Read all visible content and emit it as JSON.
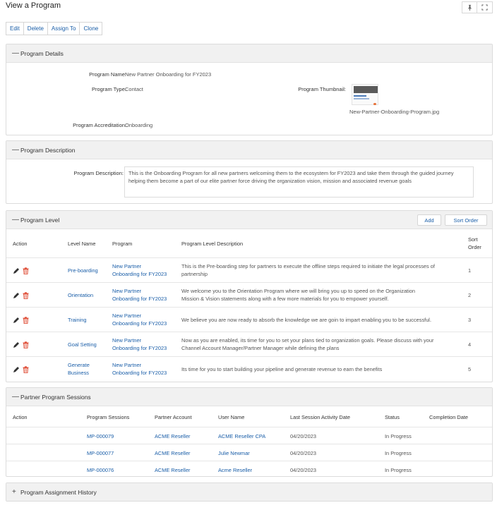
{
  "page": {
    "title": "View a Program",
    "pin_icon": "pin-icon",
    "expand_icon": "expand-icon"
  },
  "toolbar": {
    "edit": "Edit",
    "delete": "Delete",
    "assign_to": "Assign To",
    "clone": "Clone"
  },
  "details": {
    "section_title": "Program Details",
    "toggle": "—",
    "name_label": "Program Name:",
    "name_value": "New Partner Onboarding for FY2023",
    "type_label": "Program Type:",
    "type_value": "Contact",
    "thumb_label": "Program Thumbnail:",
    "thumb_file": "New-Partner-Onboarding-Program.jpg",
    "accred_label": "Program Accreditation:",
    "accred_value": "Onboarding"
  },
  "description": {
    "section_title": "Program Description",
    "toggle": "—",
    "label": "Program Description:",
    "text": "This is the Onboarding Program for all new partners welcoming them to the ecosystem for FY2023 and take them through the guided journey helping them become a part of our elite partner force driving the organization vision, mission and associated revenue goals"
  },
  "levels": {
    "section_title": "Program Level",
    "toggle": "—",
    "add_label": "Add",
    "sort_label": "Sort Order",
    "columns": {
      "action": "Action",
      "level_name": "Level Name",
      "program": "Program",
      "description": "Program Level Description",
      "sort_1": "Sort",
      "sort_2": "Order"
    },
    "rows": [
      {
        "name_1": "Pre-boarding",
        "name_2": "",
        "program_1": "New Partner",
        "program_2": "Onboarding for FY2023",
        "desc_1": "This is the Pre-boarding step for partners to execute the offline steps required to initiate the legal processes of",
        "desc_2": "partnership",
        "sort": "1"
      },
      {
        "name_1": "Orientation",
        "name_2": "",
        "program_1": "New Partner",
        "program_2": "Onboarding for FY2023",
        "desc_1": "We welcome you to the Orientation Program where we will bring you up to speed on the Organization",
        "desc_2": "Mission & Vision statements along with a few more materials for you to empower yourself.",
        "sort": "2"
      },
      {
        "name_1": "Training",
        "name_2": "",
        "program_1": "New Partner",
        "program_2": "Onboarding for FY2023",
        "desc_1": "We believe you are now ready to absorb the knowledge we are goin to impart enabling you to be successful.",
        "desc_2": "",
        "sort": "3"
      },
      {
        "name_1": "Goal Setting",
        "name_2": "",
        "program_1": "New Partner",
        "program_2": "Onboarding for FY2023",
        "desc_1": "Now as you are enabled, its time for you to set your plans tied to organization goals. Please discuss with your",
        "desc_2": "Channel Account Manager/Partner Manager while defining the plans",
        "sort": "4"
      },
      {
        "name_1": "Generate",
        "name_2": "Business",
        "program_1": "New Partner",
        "program_2": "Onboarding for FY2023",
        "desc_1": "Its time for you to start building your pipeline and generate revenue to earn the benefits",
        "desc_2": "",
        "sort": "5"
      }
    ]
  },
  "sessions": {
    "section_title": "Partner Program Sessions",
    "toggle": "—",
    "columns": {
      "action": "Action",
      "sessions": "Program Sessions",
      "account": "Partner Account",
      "user": "User Name",
      "last_date": "Last Session Activity Date",
      "status": "Status",
      "completion": "Completion Date"
    },
    "rows": [
      {
        "session": "MP-000079",
        "account": "ACME Reseller",
        "user": "ACME Reseller CPA",
        "date": "04/20/2023",
        "status": "In Progress",
        "completion": ""
      },
      {
        "session": "MP-000077",
        "account": "ACME Reseller",
        "user": "Julie Newmar",
        "date": "04/20/2023",
        "status": "In Progress",
        "completion": ""
      },
      {
        "session": "MP-000076",
        "account": "ACME Reseller",
        "user": "Acme Reseller",
        "date": "04/20/2023",
        "status": "In Progress",
        "completion": ""
      }
    ]
  },
  "history": {
    "section_title": "Program Assignment History",
    "toggle": "+"
  },
  "colors": {
    "link": "#1a5ea8",
    "panel_header": "#f1f1f1",
    "delete_icon": "#e0533d"
  }
}
